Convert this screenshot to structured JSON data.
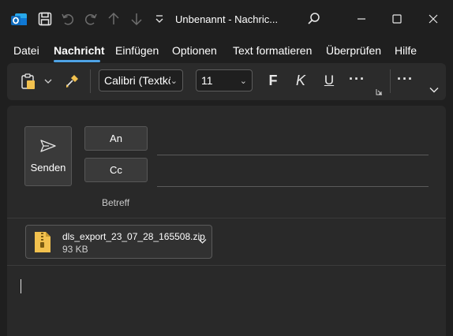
{
  "window": {
    "title": "Unbenannt  -  Nachric...",
    "app_icon": "outlook-icon",
    "controls": [
      "minimize-icon",
      "maximize-icon",
      "close-icon"
    ]
  },
  "quick_access": {
    "icons": [
      "save-icon",
      "undo-icon",
      "redo-icon",
      "arrow-up-icon",
      "arrow-down-icon",
      "customize-icon",
      "search-icon"
    ]
  },
  "menu": {
    "items": [
      {
        "label": "Datei"
      },
      {
        "label": "Nachricht",
        "active": true
      },
      {
        "label": "Einfügen"
      },
      {
        "label": "Optionen"
      },
      {
        "label": "Text formatieren"
      },
      {
        "label": "Überprüfen"
      },
      {
        "label": "Hilfe"
      }
    ]
  },
  "ribbon": {
    "font_name": "Calibri (Textkörp",
    "font_size": "11",
    "bold": "F",
    "italic": "K",
    "underline": "U",
    "more": "···",
    "more2": "···"
  },
  "compose": {
    "send_label": "Senden",
    "to_label": "An",
    "cc_label": "Cc",
    "subject_label": "Betreff",
    "to_value": "",
    "cc_value": "",
    "subject_value": ""
  },
  "attachment": {
    "name": "dls_export_23_07_28_165508.zip",
    "size": "93 KB"
  },
  "colors": {
    "background": "#1f1f1f",
    "accent": "#4fa3e6",
    "outlook_blue": "#0f6cbd",
    "zip_yellow": "#f2c14e"
  }
}
